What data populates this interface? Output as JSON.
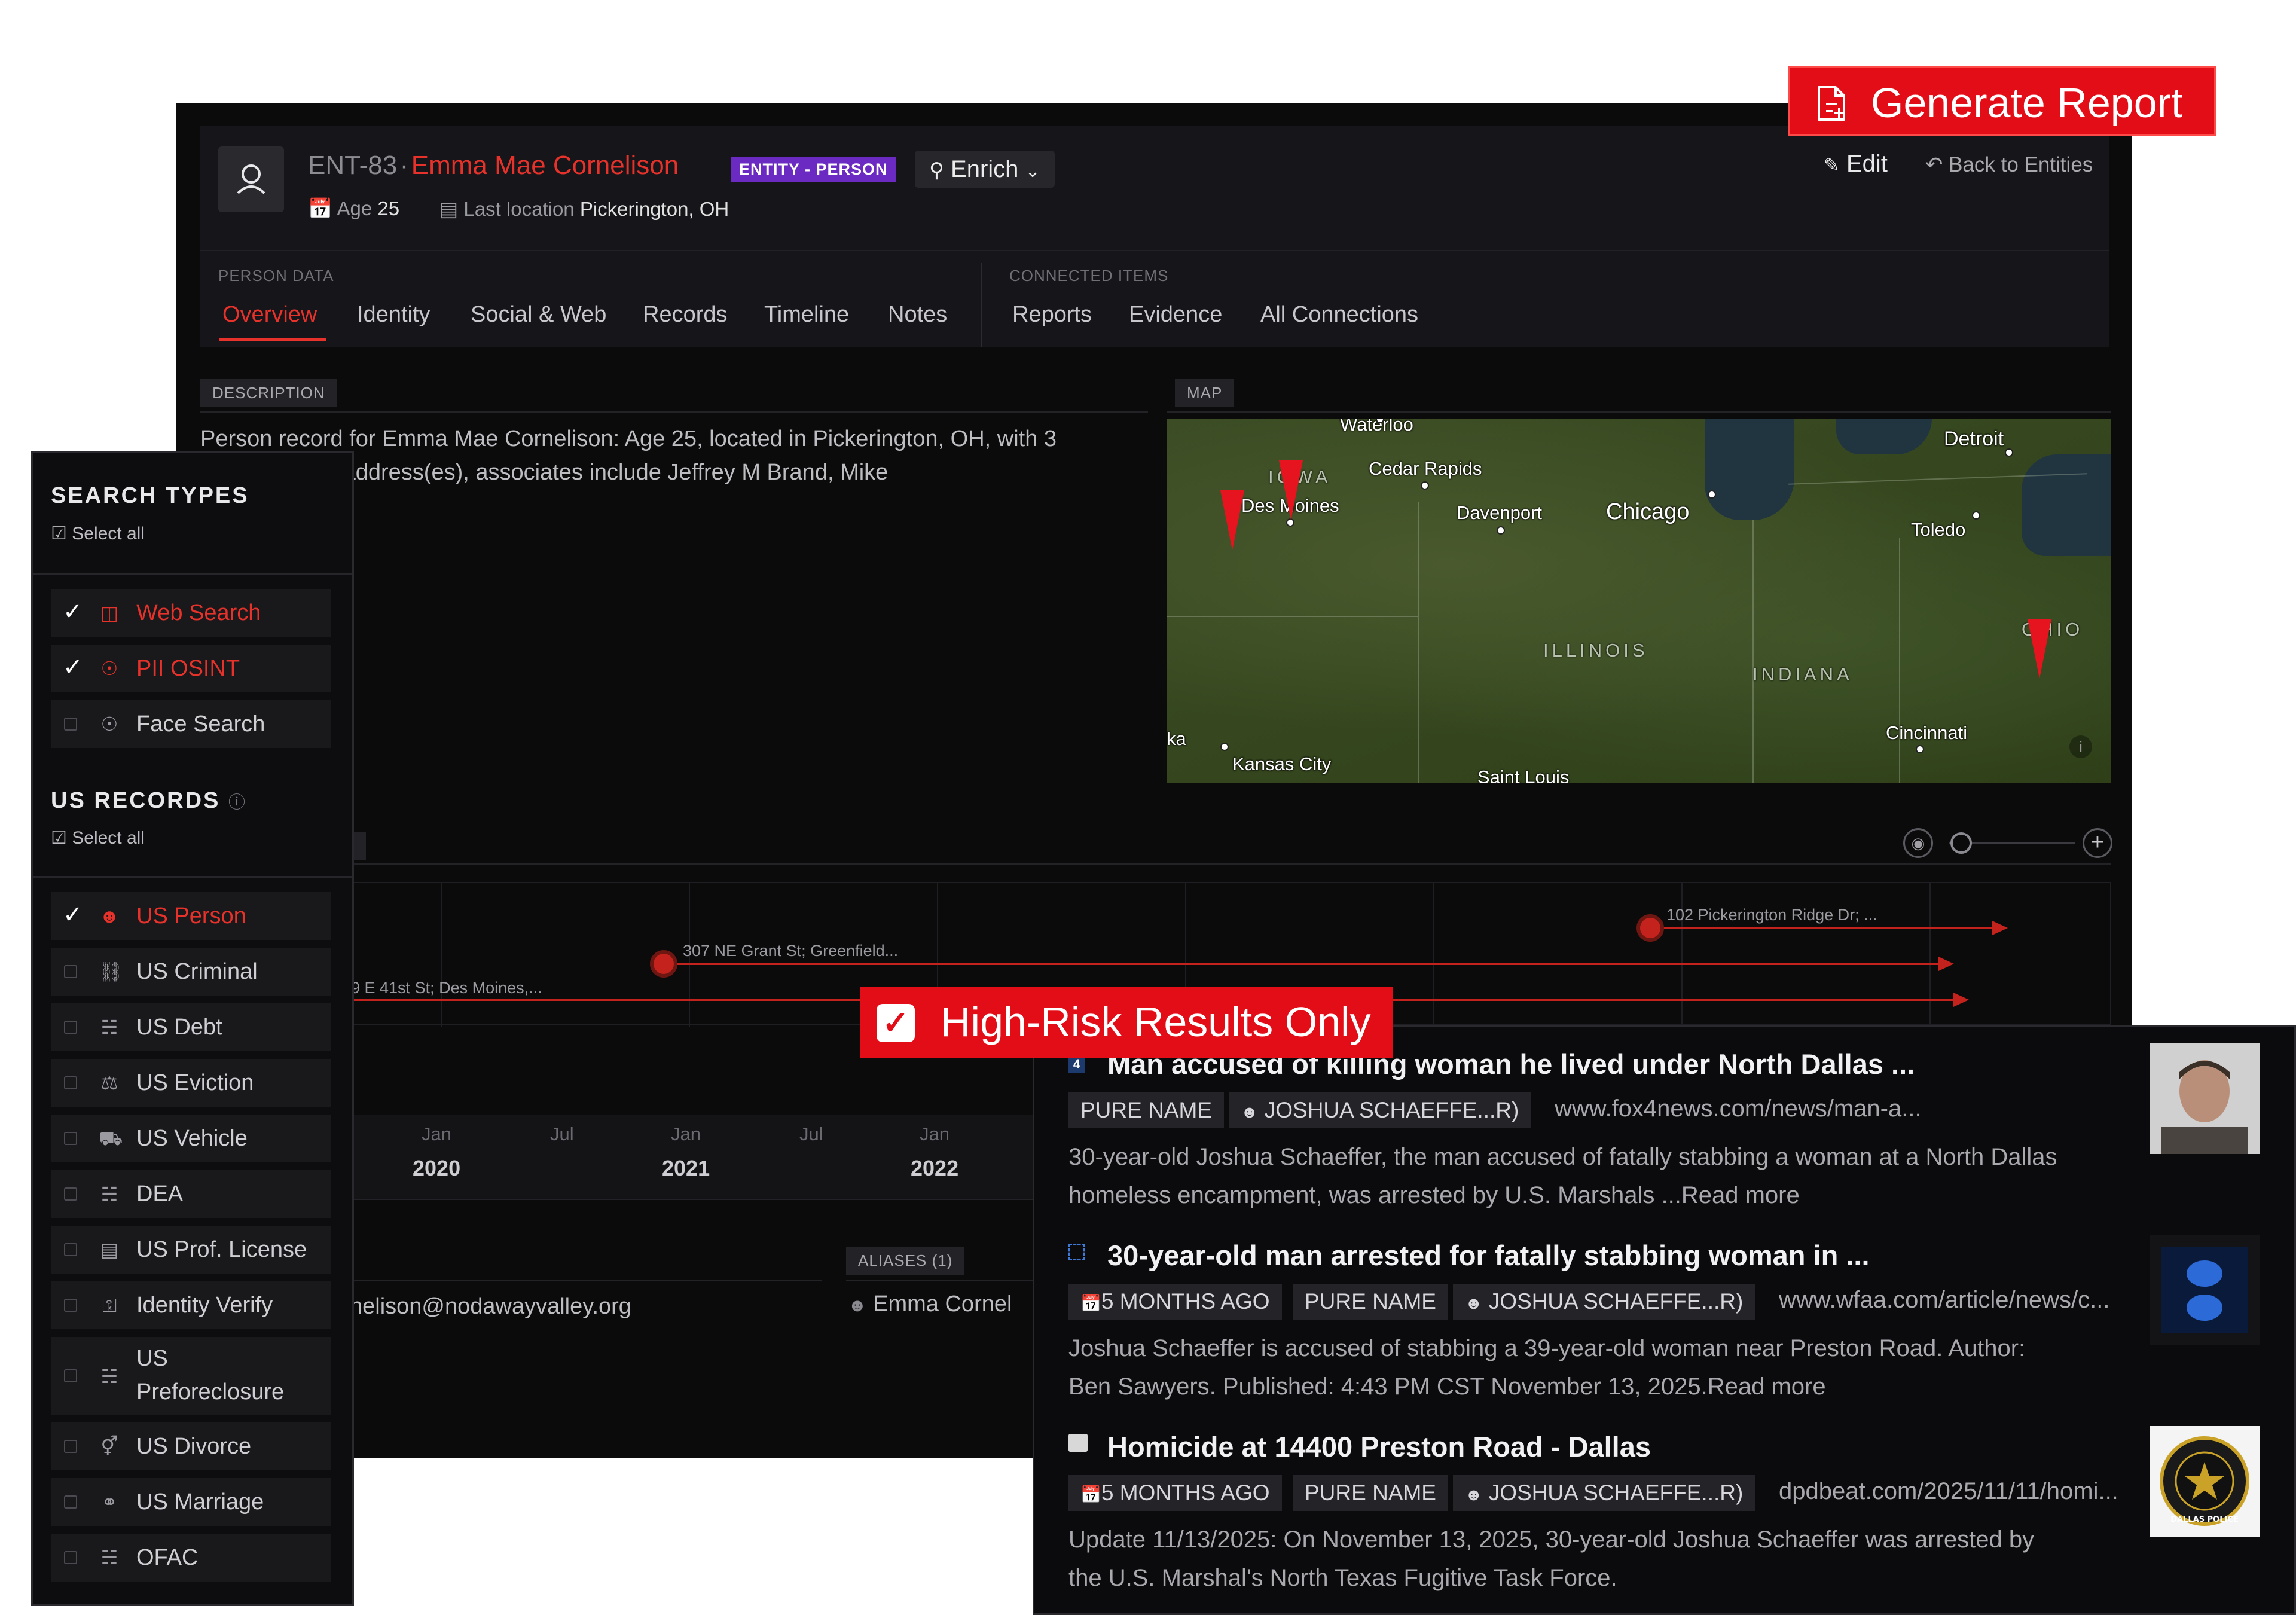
{
  "header": {
    "entity_id": "ENT-83",
    "separator": "·",
    "entity_name": "Emma Mae Cornelison",
    "badge": "ENTITY - PERSON",
    "enrich": "Enrich",
    "age_label": "Age",
    "age_value": "25",
    "location_label": "Last location",
    "location_value": "Pickerington, OH",
    "edit": "Edit",
    "back": "Back to Entities"
  },
  "generate_report": "Generate Report",
  "tabs": {
    "person_data_label": "PERSON DATA",
    "person_data": [
      "Overview",
      "Identity",
      "Social & Web",
      "Records",
      "Timeline",
      "Notes"
    ],
    "connected_label": "CONNECTED ITEMS",
    "connected": [
      "Reports",
      "Evidence",
      "All Connections"
    ]
  },
  "description": {
    "label": "DESCRIPTION",
    "line1": "Person record for Emma Mae Cornelison: Age 25, located in Pickerington, OH, with 3",
    "line2": "s(es), 1 email address(es), associates include Jeffrey M Brand, Mike"
  },
  "map": {
    "label": "MAP",
    "cities": [
      "Waterloo",
      "Cedar Rapids",
      "Des Moines",
      "Davenport",
      "Chicago",
      "Detroit",
      "Toledo",
      "Cincinnati",
      "Kansas City",
      "Saint Louis",
      "ka"
    ],
    "states": [
      "IOWA",
      "ILLINOIS",
      "INDIANA",
      "OHIO"
    ]
  },
  "timeline": {
    "label_fragment": "IE",
    "events": [
      "102 Pickerington Ridge Dr; ...",
      "307 NE Grant St; Greenfield...",
      "9 E 41st St; Des Moines,..."
    ],
    "months": [
      "Jan",
      "Jul",
      "Jan",
      "Jul",
      "Jan"
    ],
    "years": [
      "2020",
      "2021",
      "2022"
    ]
  },
  "email_value": "nelison@nodawayvalley.org",
  "aliases": {
    "label": "ALIASES (1)",
    "value": "Emma Cornel"
  },
  "search_types": {
    "title": "SEARCH TYPES",
    "select_all": "Select all",
    "items": [
      {
        "label": "Web Search",
        "checked": true
      },
      {
        "label": "PII OSINT",
        "checked": true
      },
      {
        "label": "Face Search",
        "checked": false
      }
    ]
  },
  "us_records": {
    "title": "US RECORDS",
    "select_all": "Select all",
    "items": [
      {
        "label": "US Person",
        "checked": true
      },
      {
        "label": "US Criminal",
        "checked": false
      },
      {
        "label": "US Debt",
        "checked": false
      },
      {
        "label": "US Eviction",
        "checked": false
      },
      {
        "label": "US Vehicle",
        "checked": false
      },
      {
        "label": "DEA",
        "checked": false
      },
      {
        "label": "US Prof. License",
        "checked": false
      },
      {
        "label": "Identity Verify",
        "checked": false
      },
      {
        "label": "US",
        "label2": "Preforeclosure",
        "checked": false
      },
      {
        "label": "US Divorce",
        "checked": false
      },
      {
        "label": "US Marriage",
        "checked": false
      },
      {
        "label": "OFAC",
        "checked": false
      }
    ]
  },
  "high_risk": "High-Risk Results Only",
  "results": [
    {
      "source_badge": "4",
      "title": "Man accused of killing woman he lived under North Dallas ...",
      "chips": [
        "PURE NAME",
        "JOSHUA SCHAEFFE...R)"
      ],
      "url": "www.fox4news.com/news/man-a...",
      "body1": "30-year-old Joshua Schaeffer, the man accused of fatally stabbing a woman at a North Dallas",
      "body2": "homeless encampment, was arrested by U.S. Marshals ...Read more"
    },
    {
      "title": "30-year-old man arrested for fatally stabbing woman in ...",
      "chips": [
        "5 MONTHS AGO",
        "PURE NAME",
        "JOSHUA SCHAEFFE...R)"
      ],
      "url": "www.wfaa.com/article/news/c...",
      "body1": "Joshua Schaeffer is accused of stabbing a 39-year-old woman near Preston Road. Author:",
      "body2": "Ben Sawyers. Published: 4:43 PM CST November 13, 2025.Read more"
    },
    {
      "title": "Homicide at 14400 Preston Road - Dallas",
      "chips": [
        "5 MONTHS AGO",
        "PURE NAME",
        "JOSHUA SCHAEFFE...R)"
      ],
      "url": "dpdbeat.com/2025/11/11/homi...",
      "body1": "Update 11/13/2025: On November 13, 2025, 30-year-old Joshua Schaeffer was arrested by",
      "body2": "the U.S. Marshal's North Texas Fugitive Task Force.",
      "thumb_text": "DALLAS POLICE DEPARTMENT"
    }
  ]
}
